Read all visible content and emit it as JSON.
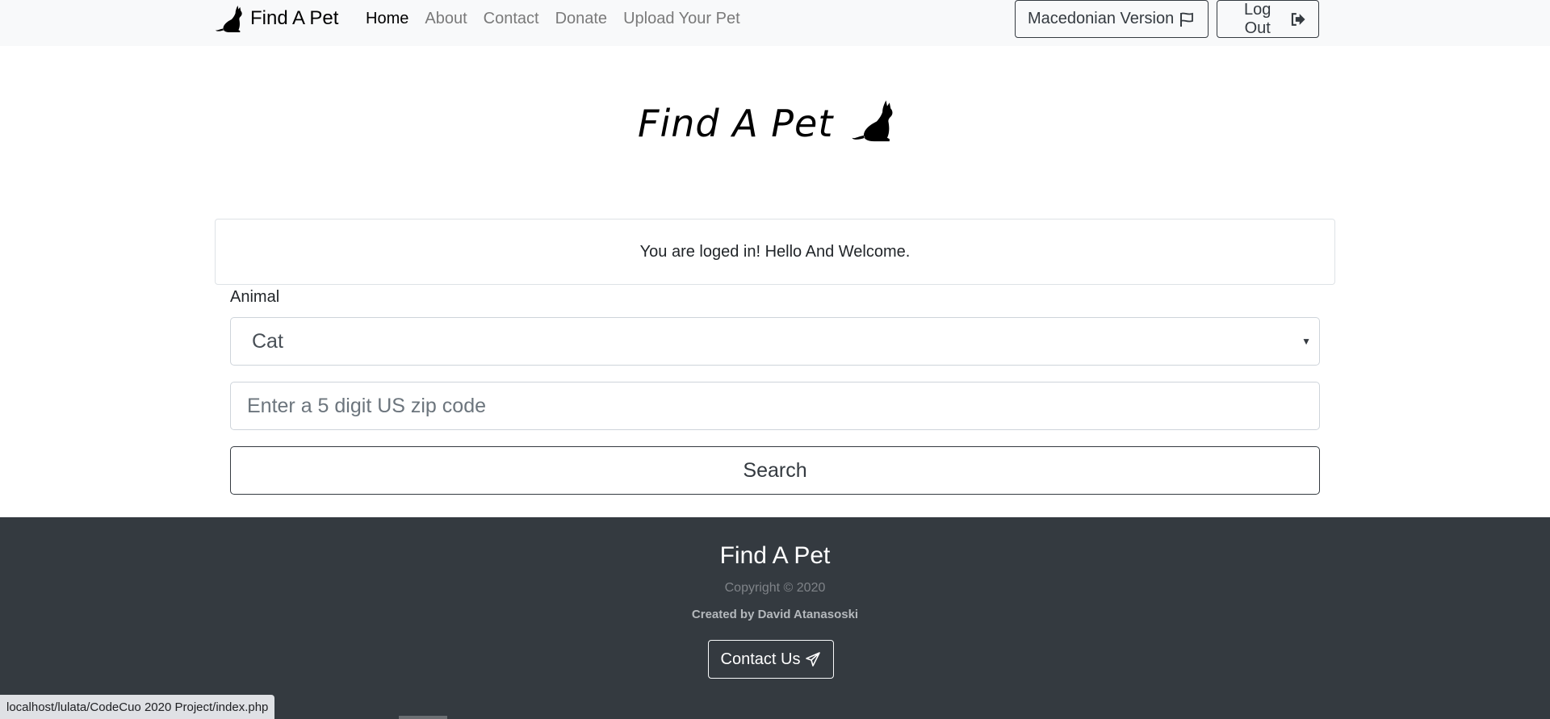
{
  "navbar": {
    "brand": "Find A Pet",
    "links": [
      "Home",
      "About",
      "Contact",
      "Donate",
      "Upload Your Pet"
    ],
    "macedonian_btn": "Macedonian Version",
    "logout_btn": "Log Out"
  },
  "logo": {
    "text": "Find A Pet"
  },
  "welcome": "You are loged in! Hello And Welcome.",
  "form": {
    "animal_label": "Animal",
    "animal_selected": "Cat",
    "zip_placeholder": "Enter a 5 digit US zip code",
    "zip_value": "",
    "search_btn": "Search"
  },
  "footer": {
    "title": "Find A Pet",
    "copyright": "Copyright © 2020",
    "created_by": "Created by David Atanasoski",
    "contact_btn": "Contact Us"
  },
  "statusbar": {
    "url": "localhost/lulata/CodeCuo 2020 Project/index.php"
  },
  "icons": {
    "brand": "cat-icon",
    "macedonian": "flag-icon",
    "logout": "sign-out-icon",
    "logo": "cat-icon",
    "contact": "paper-plane-icon"
  }
}
